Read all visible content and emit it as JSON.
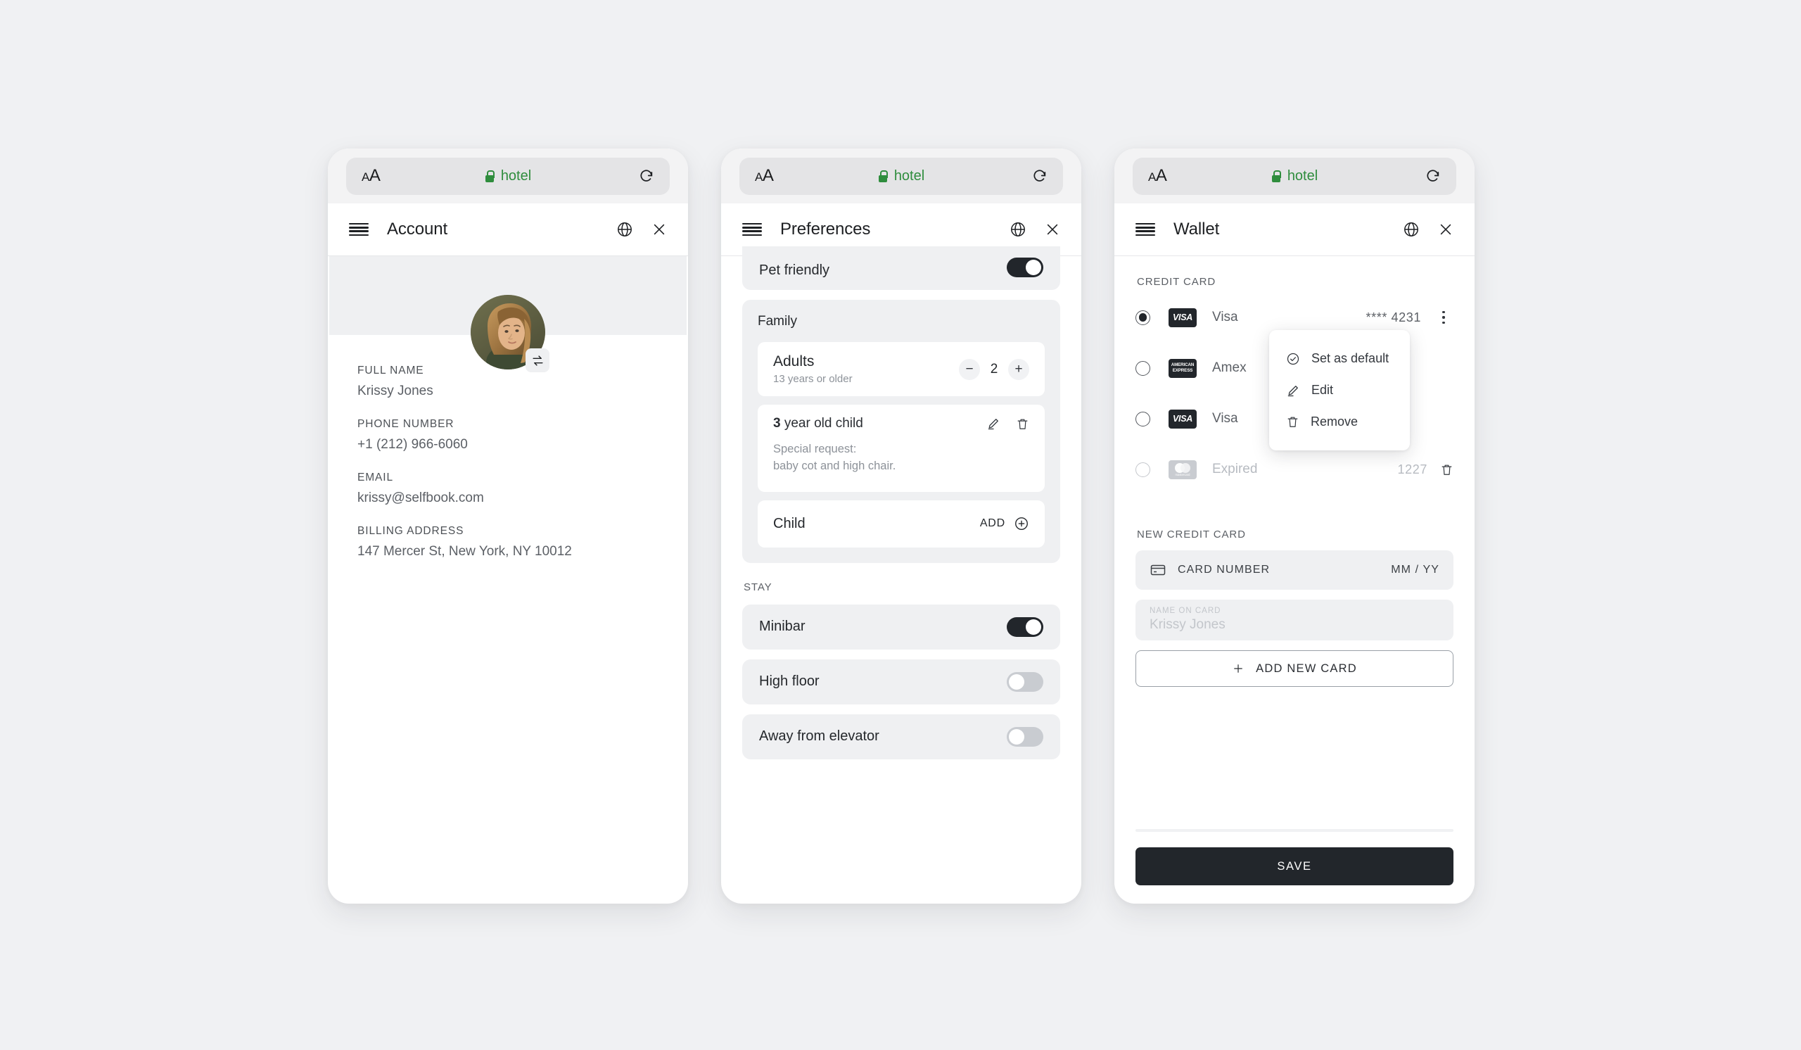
{
  "browser": {
    "text_size_label": "AA",
    "lock_icon": "lock-icon",
    "host": "hotel",
    "reload_icon": "reload-icon"
  },
  "panels": {
    "account": {
      "title": "Account",
      "menu_icon": "hamburger-icon",
      "globe_icon": "globe-icon",
      "close_icon": "close-icon",
      "avatar_alt": "Krissy Jones profile photo",
      "swap_icon": "swap-photo-icon",
      "fields": [
        {
          "label": "FULL NAME",
          "value": "Krissy Jones"
        },
        {
          "label": "PHONE NUMBER",
          "value": "+1 (212) 966-6060"
        },
        {
          "label": "EMAIL",
          "value": "krissy@selfbook.com"
        },
        {
          "label": "BILLING ADDRESS",
          "value": "147 Mercer St, New York, NY 10012"
        }
      ]
    },
    "preferences": {
      "title": "Preferences",
      "menu_icon": "hamburger-icon",
      "globe_icon": "globe-icon",
      "close_icon": "close-icon",
      "pet_friendly": {
        "label": "Pet friendly",
        "on": true
      },
      "family": {
        "title": "Family",
        "adults": {
          "name": "Adults",
          "sub": "13 years or older",
          "count": "2",
          "minus_label": "−",
          "plus_label": "+"
        },
        "child": {
          "age": "3",
          "suffix": " year old child",
          "request_label": "Special request:",
          "request_value": "baby cot and high chair.",
          "edit_icon": "pencil-icon",
          "delete_icon": "trash-icon"
        },
        "add_child": {
          "label": "Child",
          "action": "ADD",
          "icon": "plus-circle-icon"
        }
      },
      "stay_label": "STAY",
      "stay_items": [
        {
          "label": "Minibar",
          "on": true
        },
        {
          "label": "High floor",
          "on": false
        },
        {
          "label": "Away from elevator",
          "on": false
        }
      ]
    },
    "wallet": {
      "title": "Wallet",
      "menu_icon": "hamburger-icon",
      "globe_icon": "globe-icon",
      "close_icon": "close-icon",
      "credit_card_label": "CREDIT CARD",
      "cards": [
        {
          "brand": "visa",
          "brand_text": "VISA",
          "name": "Visa",
          "detail": "**** 4231",
          "selected": true,
          "expired": false,
          "menu_icon": "kebab-menu-icon"
        },
        {
          "brand": "amex",
          "brand_text": "AMERICAN EXPRESS",
          "name": "Amex",
          "detail": "",
          "selected": false,
          "expired": false,
          "menu_icon": ""
        },
        {
          "brand": "visa",
          "brand_text": "VISA",
          "name": "Visa",
          "detail": "",
          "selected": false,
          "expired": false,
          "menu_icon": ""
        },
        {
          "brand": "mastercard",
          "brand_text": "mastercard",
          "name": "Expired",
          "detail": "1227",
          "selected": false,
          "expired": true,
          "menu_icon": "trash-icon"
        }
      ],
      "context_menu": [
        {
          "label": "Set as default",
          "icon": "check-circle-icon"
        },
        {
          "label": "Edit",
          "icon": "pencil-icon"
        },
        {
          "label": "Remove",
          "icon": "trash-icon"
        }
      ],
      "new_card_label": "NEW CREDIT CARD",
      "card_number_placeholder": "CARD NUMBER",
      "card_number_icon": "credit-card-icon",
      "expiry_placeholder": "MM / YY",
      "name_on_card_label": "NAME ON CARD",
      "name_on_card_value": "Krissy Jones",
      "add_new_card_label": "ADD NEW CARD",
      "add_new_card_icon": "plus-icon",
      "save_label": "SAVE"
    }
  },
  "colors": {
    "accent_dark": "#22262b",
    "secure_green": "#2f8d3d",
    "surface": "#eff0f2",
    "page_background": "#f0f1f3"
  }
}
